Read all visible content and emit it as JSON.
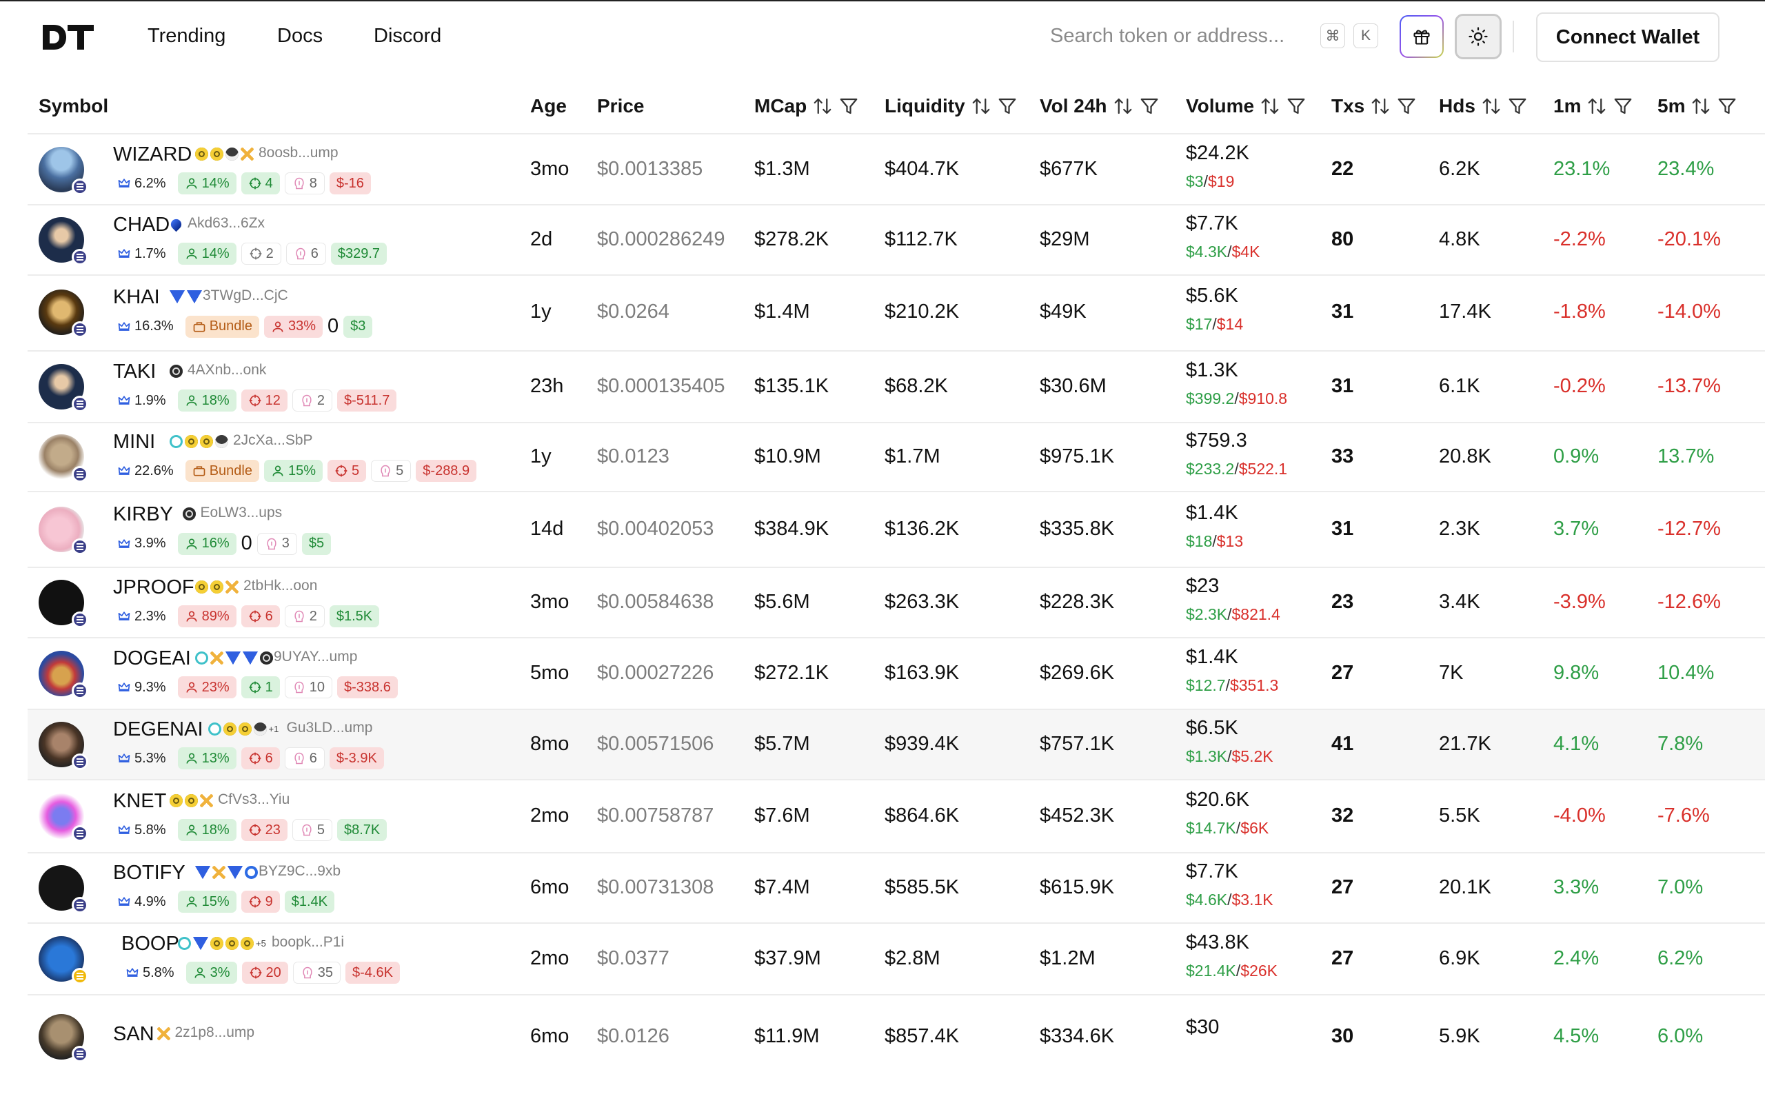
{
  "logo": "DT",
  "nav": [
    "Trending",
    "Docs",
    "Discord"
  ],
  "search": {
    "placeholder": "Search token or address...",
    "keys": [
      "⌘",
      "K"
    ]
  },
  "connect_label": "Connect Wallet",
  "columns": [
    {
      "label": "Symbol",
      "sort": false,
      "filter": false
    },
    {
      "label": "Age",
      "sort": false,
      "filter": false
    },
    {
      "label": "Price",
      "sort": false,
      "filter": false
    },
    {
      "label": "MCap",
      "sort": true,
      "filter": true
    },
    {
      "label": "Liquidity",
      "sort": true,
      "filter": true
    },
    {
      "label": "Vol 24h",
      "sort": true,
      "filter": true
    },
    {
      "label": "Volume",
      "sort": true,
      "filter": true
    },
    {
      "label": "Txs",
      "sort": true,
      "filter": true
    },
    {
      "label": "Hds",
      "sort": true,
      "filter": true
    },
    {
      "label": "1m",
      "sort": true,
      "filter": true
    },
    {
      "label": "5m",
      "sort": true,
      "filter": true
    }
  ],
  "colors": {
    "positive": "#2e9e46",
    "negative": "#d9302b",
    "chain_solana": "#3b3f88",
    "chain_bnb": "#f0b90b"
  },
  "rows": [
    {
      "symbol": "WIZARD",
      "address": "8oosb...ump",
      "icons": [
        "pill",
        "pill",
        "web",
        "x"
      ],
      "chain": "solana",
      "badges": [
        {
          "t": "crown",
          "v": "6.2%"
        },
        {
          "t": "holders",
          "v": "14%",
          "c": "green"
        },
        {
          "t": "snipers",
          "v": "4",
          "c": "green"
        },
        {
          "t": "insiders",
          "v": "8",
          "c": "grey"
        },
        {
          "t": "pnl",
          "v": "$-16",
          "c": "red"
        }
      ],
      "age": "3mo",
      "price": "$0.0013385",
      "mcap": "$1.3M",
      "liquidity": "$404.7K",
      "vol24h": "$677K",
      "volume": "$24.2K",
      "buy": "$3",
      "sell": "$19",
      "txs": "22",
      "hds": "6.2K",
      "m1": "23.1%",
      "m5": "23.4%"
    },
    {
      "symbol": "CHAD",
      "address": "Akd63...6Zx",
      "icons": [
        "drop"
      ],
      "chain": "solana",
      "badges": [
        {
          "t": "crown",
          "v": "1.7%"
        },
        {
          "t": "holders",
          "v": "14%",
          "c": "green"
        },
        {
          "t": "snipers",
          "v": "2",
          "c": "grey"
        },
        {
          "t": "insiders",
          "v": "6",
          "c": "grey"
        },
        {
          "t": "pnl",
          "v": "$329.7",
          "c": "green"
        }
      ],
      "age": "2d",
      "price": "$0.000286249",
      "mcap": "$278.2K",
      "liquidity": "$112.7K",
      "vol24h": "$29M",
      "volume": "$7.7K",
      "buy": "$4.3K",
      "sell": "$4K",
      "txs": "80",
      "hds": "4.8K",
      "m1": "-2.2%",
      "m5": "-20.1%"
    },
    {
      "symbol": "KHAI",
      "address": "3TWgD...CjC",
      "icons": [
        "mtn",
        "mtn"
      ],
      "chain": "solana",
      "badges": [
        {
          "t": "crown",
          "v": "16.3%"
        },
        {
          "t": "bundle",
          "v": "Bundle",
          "c": "orange"
        },
        {
          "t": "holders",
          "v": "33%",
          "c": "red"
        },
        {
          "t": "zero",
          "v": "0"
        },
        {
          "t": "pnl",
          "v": "$3",
          "c": "green"
        }
      ],
      "age": "1y",
      "price": "$0.0264",
      "mcap": "$1.4M",
      "liquidity": "$210.2K",
      "vol24h": "$49K",
      "volume": "$5.6K",
      "buy": "$17",
      "sell": "$14",
      "txs": "31",
      "hds": "17.4K",
      "m1": "-1.8%",
      "m5": "-14.0%"
    },
    {
      "symbol": "TAKI",
      "address": "4AXnb...onk",
      "icons": [
        "dark"
      ],
      "chain": "solana",
      "badges": [
        {
          "t": "crown",
          "v": "1.9%"
        },
        {
          "t": "holders",
          "v": "18%",
          "c": "green"
        },
        {
          "t": "snipers",
          "v": "12",
          "c": "red"
        },
        {
          "t": "insiders",
          "v": "2",
          "c": "grey"
        },
        {
          "t": "pnl",
          "v": "$-511.7",
          "c": "red"
        }
      ],
      "age": "23h",
      "price": "$0.000135405",
      "mcap": "$135.1K",
      "liquidity": "$68.2K",
      "vol24h": "$30.6M",
      "volume": "$1.3K",
      "buy": "$399.2",
      "sell": "$910.8",
      "txs": "31",
      "hds": "6.1K",
      "m1": "-0.2%",
      "m5": "-13.7%"
    },
    {
      "symbol": "MINI",
      "address": "2JcXa...SbP",
      "icons": [
        "c",
        "pill",
        "pill",
        "web"
      ],
      "chain": "solana",
      "badges": [
        {
          "t": "crown",
          "v": "22.6%"
        },
        {
          "t": "bundle",
          "v": "Bundle",
          "c": "orange"
        },
        {
          "t": "holders",
          "v": "15%",
          "c": "green"
        },
        {
          "t": "snipers",
          "v": "5",
          "c": "red"
        },
        {
          "t": "insiders",
          "v": "5",
          "c": "grey"
        },
        {
          "t": "pnl",
          "v": "$-288.9",
          "c": "red"
        }
      ],
      "age": "1y",
      "price": "$0.0123",
      "mcap": "$10.9M",
      "liquidity": "$1.7M",
      "vol24h": "$975.1K",
      "volume": "$759.3",
      "buy": "$233.2",
      "sell": "$522.1",
      "txs": "33",
      "hds": "20.8K",
      "m1": "0.9%",
      "m5": "13.7%"
    },
    {
      "symbol": "KIRBY",
      "address": "EoLW3...ups",
      "icons": [
        "dark"
      ],
      "chain": "solana",
      "badges": [
        {
          "t": "crown",
          "v": "3.9%"
        },
        {
          "t": "holders",
          "v": "16%",
          "c": "green"
        },
        {
          "t": "zero",
          "v": "0"
        },
        {
          "t": "insiders",
          "v": "3",
          "c": "grey"
        },
        {
          "t": "pnl",
          "v": "$5",
          "c": "green"
        }
      ],
      "age": "14d",
      "price": "$0.00402053",
      "mcap": "$384.9K",
      "liquidity": "$136.2K",
      "vol24h": "$335.8K",
      "volume": "$1.4K",
      "buy": "$18",
      "sell": "$13",
      "txs": "31",
      "hds": "2.3K",
      "m1": "3.7%",
      "m5": "-12.7%"
    },
    {
      "symbol": "JPROOF",
      "address": "2tbHk...oon",
      "icons": [
        "pill",
        "pill",
        "x"
      ],
      "chain": "solana",
      "badges": [
        {
          "t": "crown",
          "v": "2.3%"
        },
        {
          "t": "holders",
          "v": "89%",
          "c": "red"
        },
        {
          "t": "snipers",
          "v": "6",
          "c": "red"
        },
        {
          "t": "insiders",
          "v": "2",
          "c": "grey"
        },
        {
          "t": "pnl",
          "v": "$1.5K",
          "c": "green"
        }
      ],
      "age": "3mo",
      "price": "$0.00584638",
      "mcap": "$5.6M",
      "liquidity": "$263.3K",
      "vol24h": "$228.3K",
      "volume": "$23",
      "buy": "$2.3K",
      "sell": "$821.4",
      "txs": "23",
      "hds": "3.4K",
      "m1": "-3.9%",
      "m5": "-12.6%"
    },
    {
      "symbol": "DOGEAI",
      "address": "9UYAY...ump",
      "icons": [
        "c",
        "x",
        "mtn",
        "mtn",
        "dark"
      ],
      "chain": "solana",
      "badges": [
        {
          "t": "crown",
          "v": "9.3%"
        },
        {
          "t": "holders",
          "v": "23%",
          "c": "red"
        },
        {
          "t": "snipers",
          "v": "1",
          "c": "green"
        },
        {
          "t": "insiders",
          "v": "10",
          "c": "grey"
        },
        {
          "t": "pnl",
          "v": "$-338.6",
          "c": "red"
        }
      ],
      "age": "5mo",
      "price": "$0.00027226",
      "mcap": "$272.1K",
      "liquidity": "$163.9K",
      "vol24h": "$269.6K",
      "volume": "$1.4K",
      "buy": "$12.7",
      "sell": "$351.3",
      "txs": "27",
      "hds": "7K",
      "m1": "9.8%",
      "m5": "10.4%"
    },
    {
      "symbol": "DEGENAI",
      "address": "Gu3LD...ump",
      "icons": [
        "c",
        "pill",
        "pill",
        "web",
        "plus"
      ],
      "plus": "+1",
      "chain": "solana",
      "badges": [
        {
          "t": "crown",
          "v": "5.3%"
        },
        {
          "t": "holders",
          "v": "13%",
          "c": "green"
        },
        {
          "t": "snipers",
          "v": "6",
          "c": "red"
        },
        {
          "t": "insiders",
          "v": "6",
          "c": "grey"
        },
        {
          "t": "pnl",
          "v": "$-3.9K",
          "c": "red"
        }
      ],
      "age": "8mo",
      "price": "$0.00571506",
      "mcap": "$5.7M",
      "liquidity": "$939.4K",
      "vol24h": "$757.1K",
      "volume": "$6.5K",
      "buy": "$1.3K",
      "sell": "$5.2K",
      "txs": "41",
      "hds": "21.7K",
      "m1": "4.1%",
      "m5": "7.8%",
      "highlight": true
    },
    {
      "symbol": "KNET",
      "address": "CfVs3...Yiu",
      "icons": [
        "pill",
        "pill",
        "x"
      ],
      "chain": "solana",
      "badges": [
        {
          "t": "crown",
          "v": "5.8%"
        },
        {
          "t": "holders",
          "v": "18%",
          "c": "green"
        },
        {
          "t": "snipers",
          "v": "23",
          "c": "red"
        },
        {
          "t": "insiders",
          "v": "5",
          "c": "grey"
        },
        {
          "t": "pnl",
          "v": "$8.7K",
          "c": "green"
        }
      ],
      "age": "2mo",
      "price": "$0.00758787",
      "mcap": "$7.6M",
      "liquidity": "$864.6K",
      "vol24h": "$452.3K",
      "volume": "$20.6K",
      "buy": "$14.7K",
      "sell": "$6K",
      "txs": "32",
      "hds": "5.5K",
      "m1": "-4.0%",
      "m5": "-7.6%"
    },
    {
      "symbol": "BOTIFY",
      "address": "BYZ9C...9xb",
      "icons": [
        "mtn",
        "x",
        "mtn",
        "ring"
      ],
      "chain": "solana",
      "badges": [
        {
          "t": "crown",
          "v": "4.9%"
        },
        {
          "t": "holders",
          "v": "15%",
          "c": "green"
        },
        {
          "t": "snipers",
          "v": "9",
          "c": "red"
        },
        {
          "t": "pnl",
          "v": "$1.4K",
          "c": "green"
        }
      ],
      "age": "6mo",
      "price": "$0.00731308",
      "mcap": "$7.4M",
      "liquidity": "$585.5K",
      "vol24h": "$615.9K",
      "volume": "$7.7K",
      "buy": "$4.6K",
      "sell": "$3.1K",
      "txs": "27",
      "hds": "20.1K",
      "m1": "3.3%",
      "m5": "7.0%"
    },
    {
      "symbol": "BOOP",
      "address": "boopk...P1i",
      "icons": [
        "c",
        "mtn",
        "pill",
        "pill",
        "pill",
        "plus"
      ],
      "plus": "+5",
      "chain": "bnb",
      "badges": [
        {
          "t": "crown",
          "v": "5.8%"
        },
        {
          "t": "holders",
          "v": "3%",
          "c": "green"
        },
        {
          "t": "snipers",
          "v": "20",
          "c": "red"
        },
        {
          "t": "insiders",
          "v": "35",
          "c": "grey"
        },
        {
          "t": "pnl",
          "v": "$-4.6K",
          "c": "red"
        }
      ],
      "age": "2mo",
      "price": "$0.0377",
      "mcap": "$37.9M",
      "liquidity": "$2.8M",
      "vol24h": "$1.2M",
      "volume": "$43.8K",
      "buy": "$21.4K",
      "sell": "$26K",
      "txs": "27",
      "hds": "6.9K",
      "m1": "2.4%",
      "m5": "6.2%"
    },
    {
      "symbol": "SAN",
      "address": "2z1p8...ump",
      "icons": [
        "x"
      ],
      "chain": "solana",
      "badges": [],
      "age": "6mo",
      "price": "$0.0126",
      "mcap": "$11.9M",
      "liquidity": "$857.4K",
      "vol24h": "$334.6K",
      "volume": "$30",
      "buy": "",
      "sell": "",
      "txs": "30",
      "hds": "5.9K",
      "m1": "4.5%",
      "m5": "6.0%"
    }
  ]
}
